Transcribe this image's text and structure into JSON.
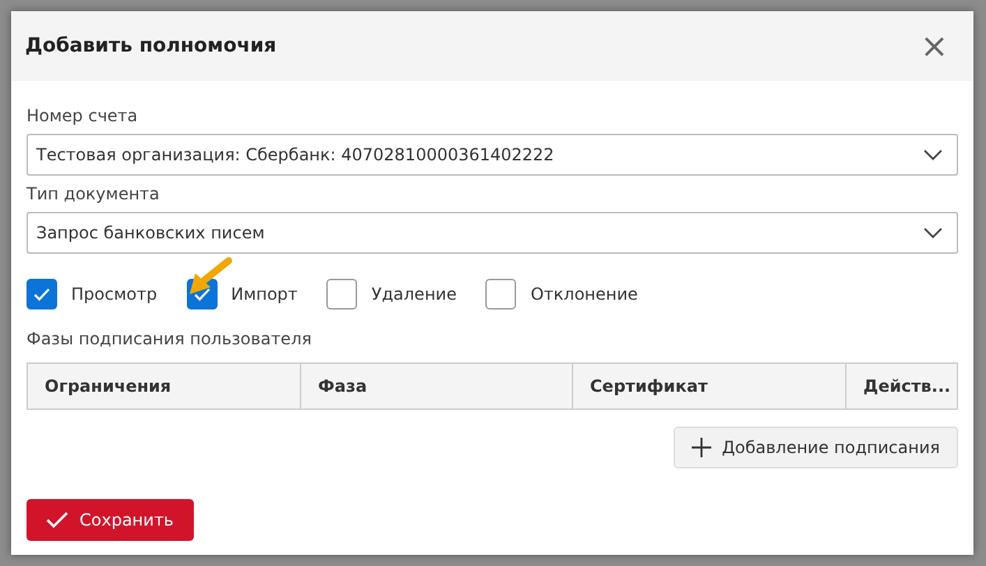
{
  "dialog": {
    "title": "Добавить полномочия",
    "close": "×"
  },
  "fields": [
    {
      "label": "Номер счета",
      "value": "Тестовая организация: Сбербанк: 40702810000361402222"
    },
    {
      "label": "Тип документа",
      "value": "Запрос банковских писем"
    }
  ],
  "permissions": [
    {
      "label": "Просмотр",
      "checked": true
    },
    {
      "label": "Импорт",
      "checked": true
    },
    {
      "label": "Удаление",
      "checked": false
    },
    {
      "label": "Отклонение",
      "checked": false
    }
  ],
  "phases": {
    "title": "Фазы подписания пользователя",
    "columns": [
      "Ограничения",
      "Фаза",
      "Сертификат",
      "Действ..."
    ],
    "add_button": "Добавление подписания"
  },
  "save_button": "Сохранить"
}
